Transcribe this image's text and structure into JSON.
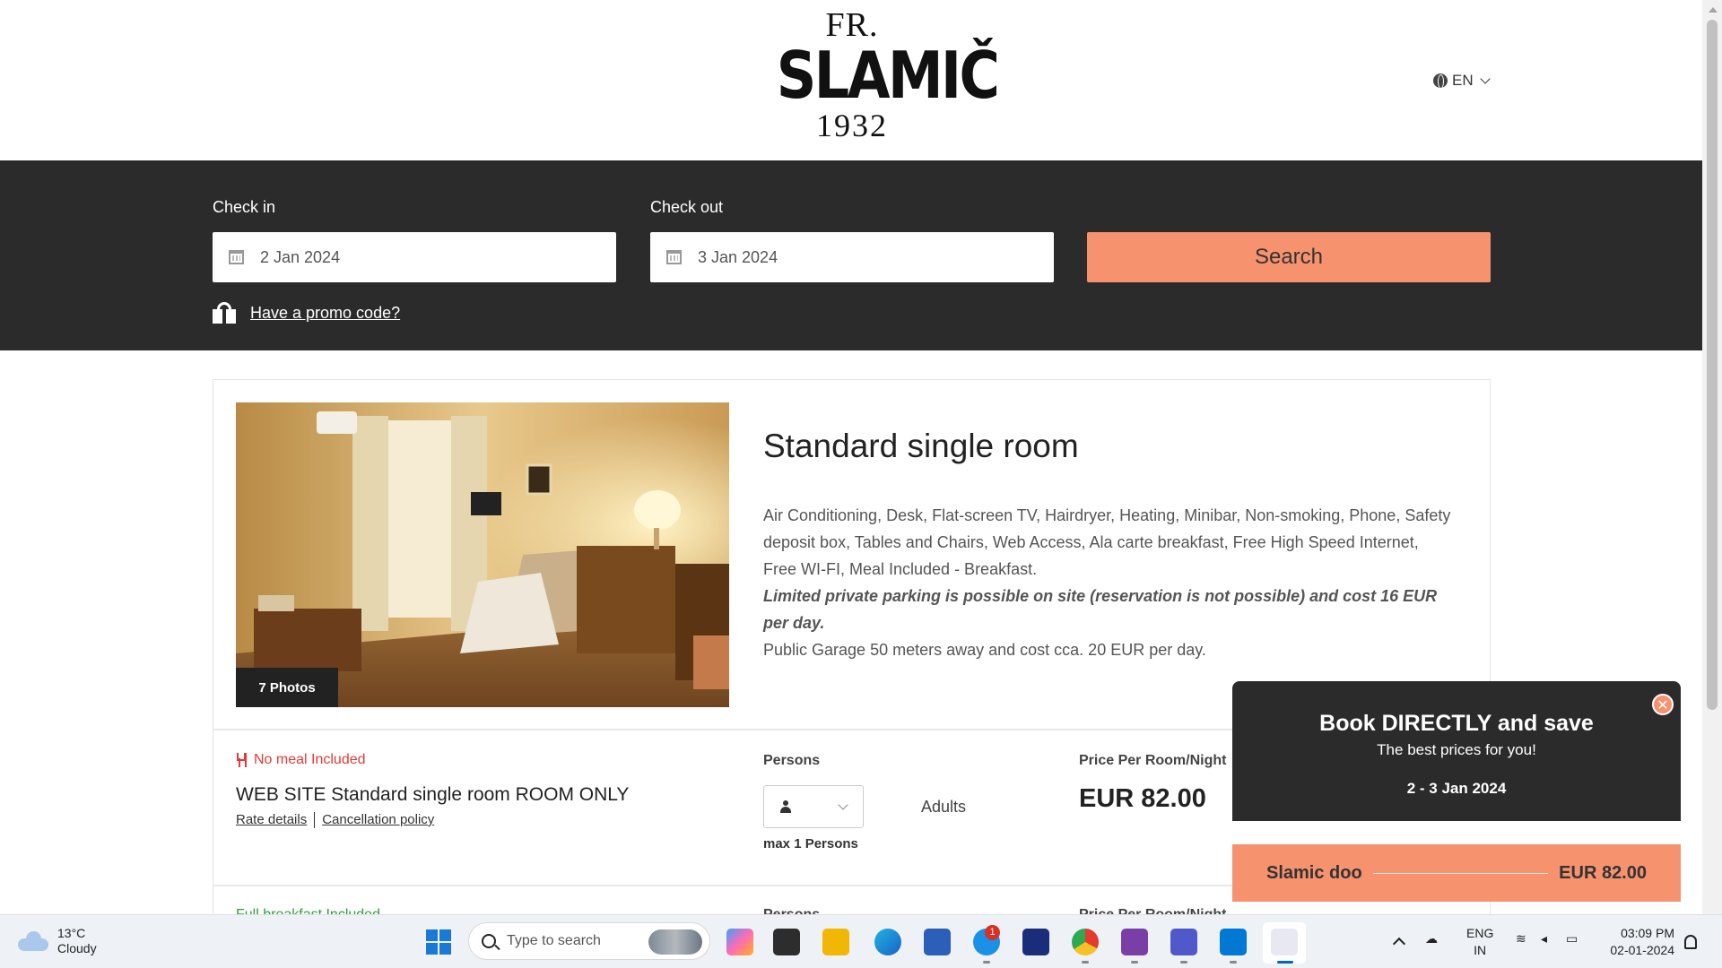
{
  "header": {
    "logo": {
      "line1": "FR.",
      "line2": "SLAMIČ",
      "line3": "1932"
    },
    "language": "EN"
  },
  "search": {
    "checkin_label": "Check in",
    "checkin_value": "2 Jan 2024",
    "checkout_label": "Check out",
    "checkout_value": "3 Jan 2024",
    "search_button": "Search",
    "promo_link": "Have a promo code?"
  },
  "room": {
    "photos_badge": "7 Photos",
    "title": "Standard single room",
    "amenities": "Air Conditioning, Desk, Flat-screen TV, Hairdryer, Heating, Minibar, Non-smoking, Phone, Safety deposit box, Tables and Chairs, Web Access, Ala carte breakfast, Free High Speed Internet, Free WI-FI, Meal Included - Breakfast.",
    "parking_note": "Limited private parking is possible on site (reservation is not possible) and cost 16 EUR per day.",
    "garage_note": "Public Garage 50 meters away and cost cca. 20 EUR per day.",
    "rate": {
      "meal": "No meal Included",
      "name": "WEB SITE Standard single room ROOM ONLY",
      "rate_details": "Rate details",
      "cancellation_policy": "Cancellation policy",
      "persons_label": "Persons",
      "max_persons": "max 1 Persons",
      "adults_label": "Adults",
      "price_label": "Price Per Room/Night",
      "price": "EUR 82.00"
    },
    "next_rate": {
      "meal": "Full breakfast Included",
      "persons_label": "Persons",
      "price_label": "Price Per Room/Night"
    }
  },
  "popup": {
    "title": "Book DIRECTLY and save",
    "subtitle": "The best prices for you!",
    "dates": "2 - 3 Jan 2024",
    "offer_name": "Slamic doo",
    "offer_price": "EUR 82.00",
    "close": "✕"
  },
  "taskbar": {
    "weather_temp": "13°C",
    "weather_desc": "Cloudy",
    "search_placeholder": "Type to search",
    "skype_badge": "1",
    "lang_line1": "ENG",
    "lang_line2": "IN",
    "time": "03:09 PM",
    "date": "02-01-2024"
  },
  "colors": {
    "accent": "#f7926f",
    "dark_band": "#2b2b2b",
    "meal_red": "#e53935"
  }
}
